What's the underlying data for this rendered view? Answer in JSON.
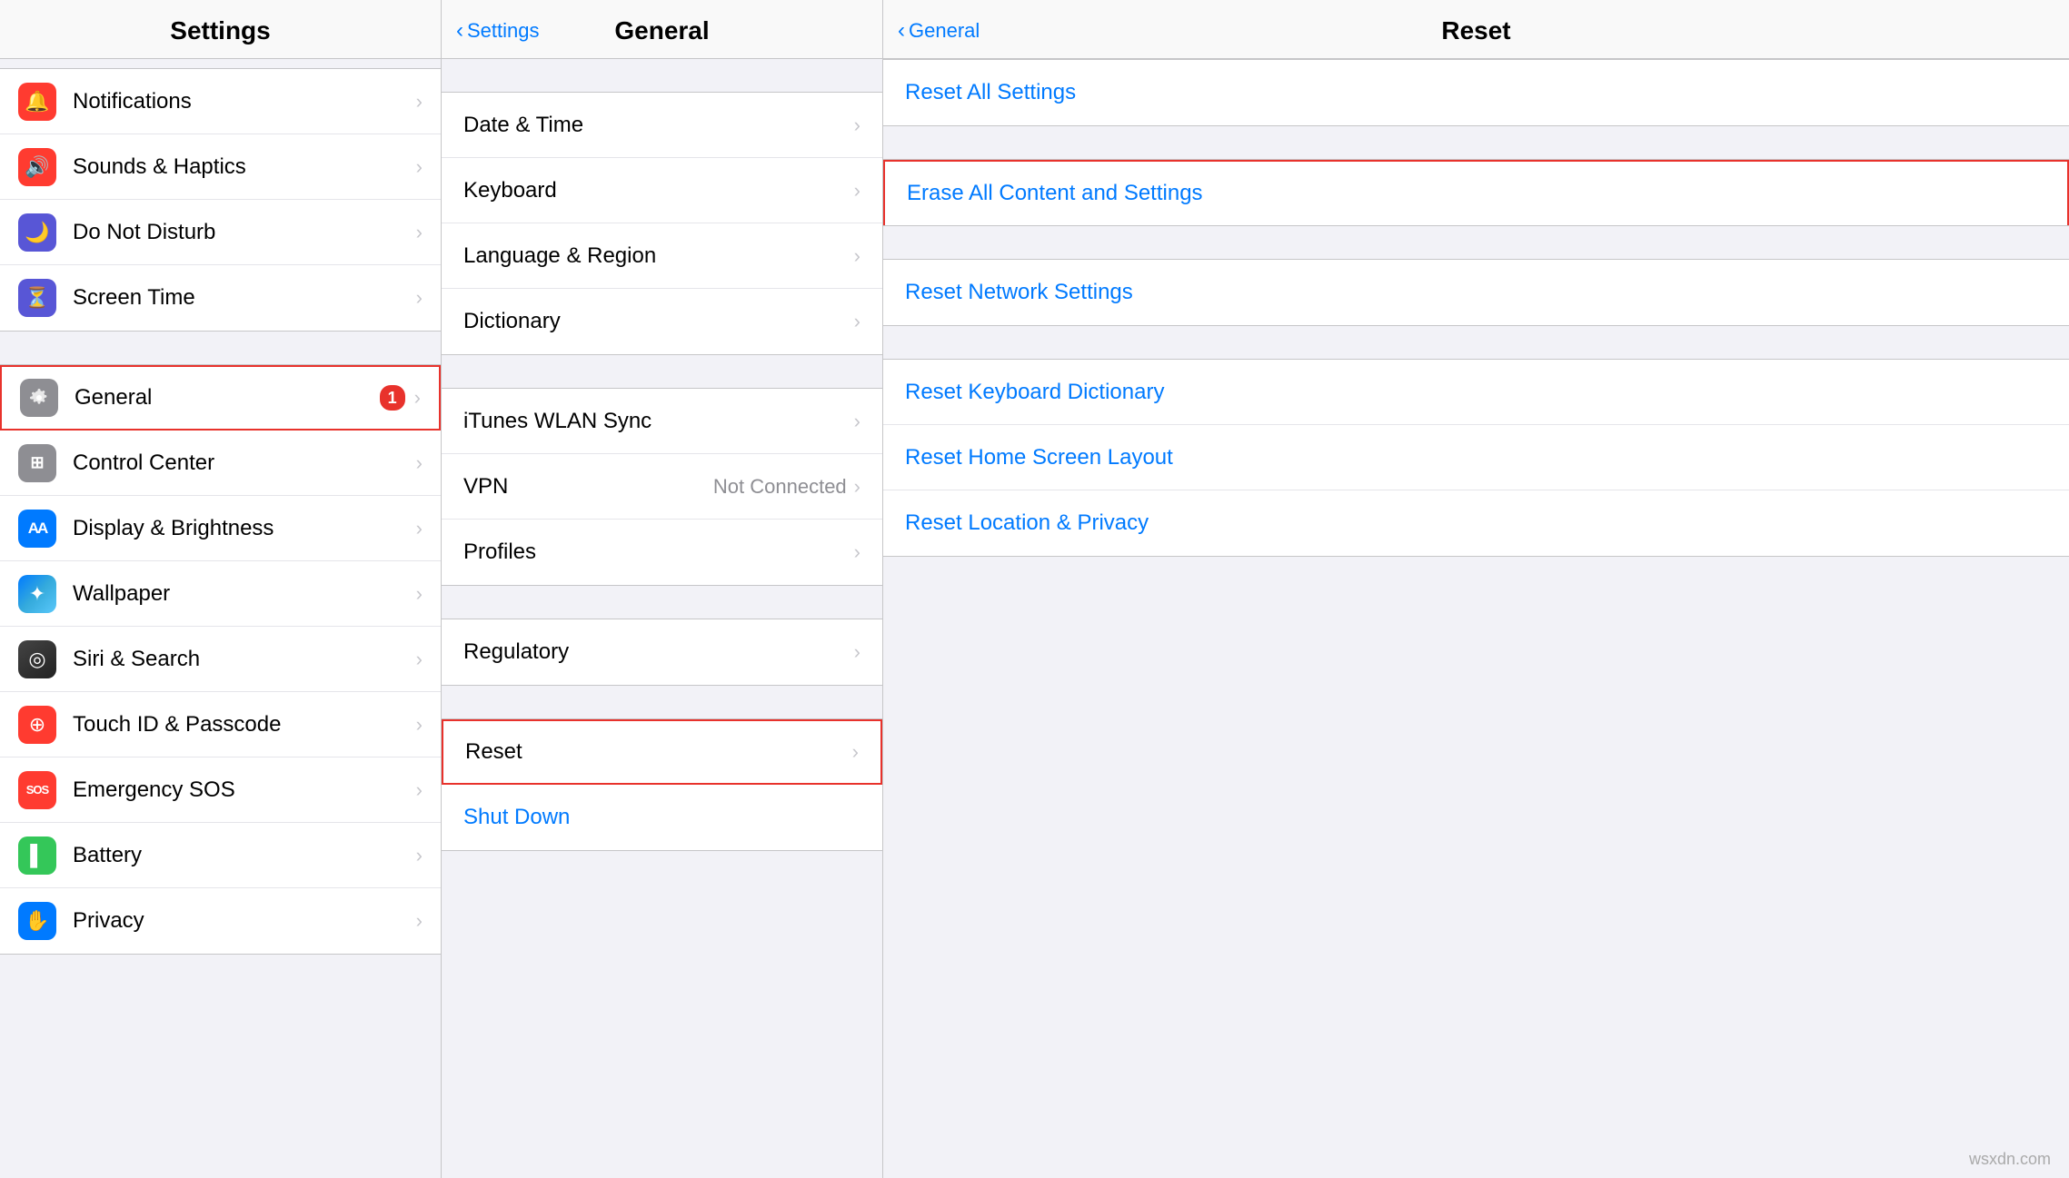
{
  "settings": {
    "title": "Settings",
    "items": [
      {
        "id": "notifications",
        "label": "Notifications",
        "icon_bg": "#ff3b30",
        "icon": "🔔",
        "selected": false
      },
      {
        "id": "sounds",
        "label": "Sounds & Haptics",
        "icon_bg": "#ff3b30",
        "icon": "🔊",
        "selected": false
      },
      {
        "id": "donotdisturb",
        "label": "Do Not Disturb",
        "icon_bg": "#5856d6",
        "icon": "🌙",
        "selected": false
      },
      {
        "id": "screentime",
        "label": "Screen Time",
        "icon_bg": "#5856d6",
        "icon": "⏳",
        "selected": false
      }
    ],
    "items2": [
      {
        "id": "general",
        "label": "General",
        "icon_bg": "#8e8e93",
        "icon": "⚙️",
        "badge": "1",
        "selected": true
      },
      {
        "id": "controlcenter",
        "label": "Control Center",
        "icon_bg": "#8e8e93",
        "icon": "◉",
        "selected": false
      },
      {
        "id": "displaybrightness",
        "label": "Display & Brightness",
        "icon_bg": "#007aff",
        "icon": "AA",
        "selected": false
      },
      {
        "id": "wallpaper",
        "label": "Wallpaper",
        "icon_bg": "#34aadc",
        "icon": "✦",
        "selected": false
      },
      {
        "id": "sirisearch",
        "label": "Siri & Search",
        "icon_bg": "linear-gradient(135deg, #000 0%, #5f5f5f 100%)",
        "icon": "◎",
        "selected": false
      },
      {
        "id": "touchid",
        "label": "Touch ID & Passcode",
        "icon_bg": "#ff3b30",
        "icon": "✿",
        "selected": false
      },
      {
        "id": "emergencysos",
        "label": "Emergency SOS",
        "icon_bg": "#ff3b30",
        "icon": "SOS",
        "selected": false
      },
      {
        "id": "battery",
        "label": "Battery",
        "icon_bg": "#34c759",
        "icon": "▌",
        "selected": false
      },
      {
        "id": "privacy",
        "label": "Privacy",
        "icon_bg": "#007aff",
        "icon": "✋",
        "selected": false
      }
    ]
  },
  "general": {
    "title": "General",
    "back_label": "Settings",
    "items_top": [
      {
        "id": "datetime",
        "label": "Date & Time"
      },
      {
        "id": "keyboard",
        "label": "Keyboard"
      },
      {
        "id": "language",
        "label": "Language & Region"
      },
      {
        "id": "dictionary",
        "label": "Dictionary"
      }
    ],
    "items_mid": [
      {
        "id": "itunes",
        "label": "iTunes WLAN Sync"
      },
      {
        "id": "vpn",
        "label": "VPN",
        "value": "Not Connected"
      },
      {
        "id": "profiles",
        "label": "Profiles"
      }
    ],
    "items_bottom": [
      {
        "id": "regulatory",
        "label": "Regulatory"
      }
    ],
    "items_last": [
      {
        "id": "reset",
        "label": "Reset",
        "selected": true
      },
      {
        "id": "shutdown",
        "label": "Shut Down",
        "blue": true
      }
    ]
  },
  "reset": {
    "title": "Reset",
    "back_label": "General",
    "groups": [
      {
        "items": [
          {
            "id": "reset-all-settings",
            "label": "Reset All Settings",
            "highlighted": false
          }
        ]
      },
      {
        "items": [
          {
            "id": "erase-all",
            "label": "Erase All Content and Settings",
            "highlighted": true
          }
        ]
      },
      {
        "items": [
          {
            "id": "reset-network",
            "label": "Reset Network Settings",
            "highlighted": false
          }
        ]
      },
      {
        "items": [
          {
            "id": "reset-keyboard",
            "label": "Reset Keyboard Dictionary",
            "highlighted": false
          },
          {
            "id": "reset-home",
            "label": "Reset Home Screen Layout",
            "highlighted": false
          },
          {
            "id": "reset-location",
            "label": "Reset Location & Privacy",
            "highlighted": false
          }
        ]
      }
    ]
  },
  "watermark": "wsxdn.com"
}
